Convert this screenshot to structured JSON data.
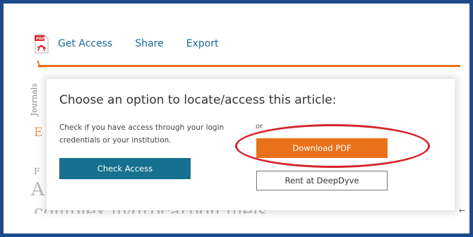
{
  "toolbar": {
    "pdf_icon": "pdf-file-icon",
    "get_access": "Get Access",
    "share": "Share",
    "export": "Export"
  },
  "background": {
    "letter_e": "E",
    "letter_f": "F",
    "letter_a": "A",
    "side_label": "Journals",
    "partial_title": "complex hydrocarbon fuels"
  },
  "modal": {
    "title": "Choose an option to locate/access this article:",
    "description": "Check if you have access through your login credentials or your institution.",
    "check_access": "Check Access",
    "or": "or",
    "download_pdf": "Download PDF",
    "rent": "Rent at DeepDyve"
  },
  "annotation": {
    "ellipse_color": "#d4232a",
    "return_glyph": "←"
  },
  "colors": {
    "frame": "#1e4a8c",
    "accent_orange": "#e9711c",
    "teal_button": "#16708f",
    "link": "#1a6a97"
  }
}
